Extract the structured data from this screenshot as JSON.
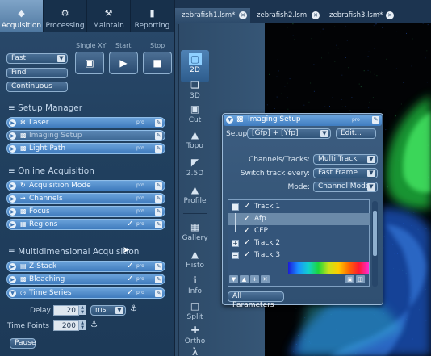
{
  "tabs": [
    {
      "label": "Acquisition",
      "icon": "camera-icon"
    },
    {
      "label": "Processing",
      "icon": "gear-icon"
    },
    {
      "label": "Maintain",
      "icon": "wrench-icon"
    },
    {
      "label": "Reporting",
      "icon": "chart-icon"
    }
  ],
  "acquisition": {
    "speed_select": "Fast",
    "find_label": "Find",
    "continuous_label": "Continuous",
    "single_xy_label": "Single XY",
    "start_label": "Start",
    "stop_label": "Stop"
  },
  "setup_manager": {
    "title": "Setup Manager",
    "rows": [
      {
        "label": "Laser",
        "pro": "pro"
      },
      {
        "label": "Imaging Setup",
        "pro": ""
      },
      {
        "label": "Light Path",
        "pro": "pro"
      }
    ]
  },
  "online_acquisition": {
    "title": "Online Acquisition",
    "rows": [
      {
        "label": "Acquisition Mode",
        "pro": "pro"
      },
      {
        "label": "Channels",
        "pro": "pro"
      },
      {
        "label": "Focus",
        "pro": "pro"
      },
      {
        "label": "Regions",
        "pro": "pro"
      }
    ]
  },
  "multidimensional": {
    "title": "Multidimensional Acquisition",
    "rows": [
      {
        "label": "Z-Stack",
        "pro": "pro"
      },
      {
        "label": "Bleaching",
        "pro": "pro"
      },
      {
        "label": "Time Series",
        "pro": "pro"
      }
    ],
    "delay_label": "Delay",
    "delay_value": "20",
    "delay_unit": "ms",
    "time_points_label": "Time Points",
    "time_points_value": "200",
    "pause_label": "Pause"
  },
  "doc_tabs": [
    {
      "label": "zebrafish1.lsm*"
    },
    {
      "label": "zebrafish2.lsm"
    },
    {
      "label": "zebrafish3.lsm*"
    }
  ],
  "views": [
    {
      "label": "2D",
      "icon": "2d-view-icon"
    },
    {
      "label": "3D",
      "icon": "3d-view-icon"
    },
    {
      "label": "Cut",
      "icon": "cut-view-icon"
    },
    {
      "label": "Topo",
      "icon": "topo-view-icon"
    },
    {
      "label": "2.5D",
      "icon": "2-5d-view-icon"
    },
    {
      "label": "Profile",
      "icon": "profile-view-icon"
    },
    {
      "label": "Gallery",
      "icon": "gallery-view-icon"
    },
    {
      "label": "Histo",
      "icon": "histo-view-icon"
    },
    {
      "label": "Info",
      "icon": "info-view-icon"
    },
    {
      "label": "Split",
      "icon": "split-view-icon"
    },
    {
      "label": "Ortho",
      "icon": "ortho-view-icon"
    },
    {
      "label": "",
      "icon": "lambda-view-icon"
    }
  ],
  "dialog": {
    "title": "Imaging Setup",
    "pro": "pro",
    "setup_label": "Setup",
    "setup_value": "[Gfp] + [Yfp]",
    "edit_label": "Edit...",
    "channels_tracks_label": "Channels/Tracks:",
    "channels_tracks_value": "Multi Track",
    "switch_track_label": "Switch track every:",
    "switch_track_value": "Fast Frame",
    "mode_label": "Mode:",
    "mode_value": "Channel Mode",
    "tracks": [
      {
        "label": "Track 1"
      },
      {
        "label": "Afp"
      },
      {
        "label": "CFP"
      },
      {
        "label": "Track 2"
      },
      {
        "label": "Track 3"
      }
    ],
    "all_parameters_label": "All Parameters"
  },
  "colors": {
    "accent": "#4f8fd0",
    "panel": "#21405f",
    "image_green": "#2fd34a",
    "image_blue": "#2a6bd8"
  }
}
